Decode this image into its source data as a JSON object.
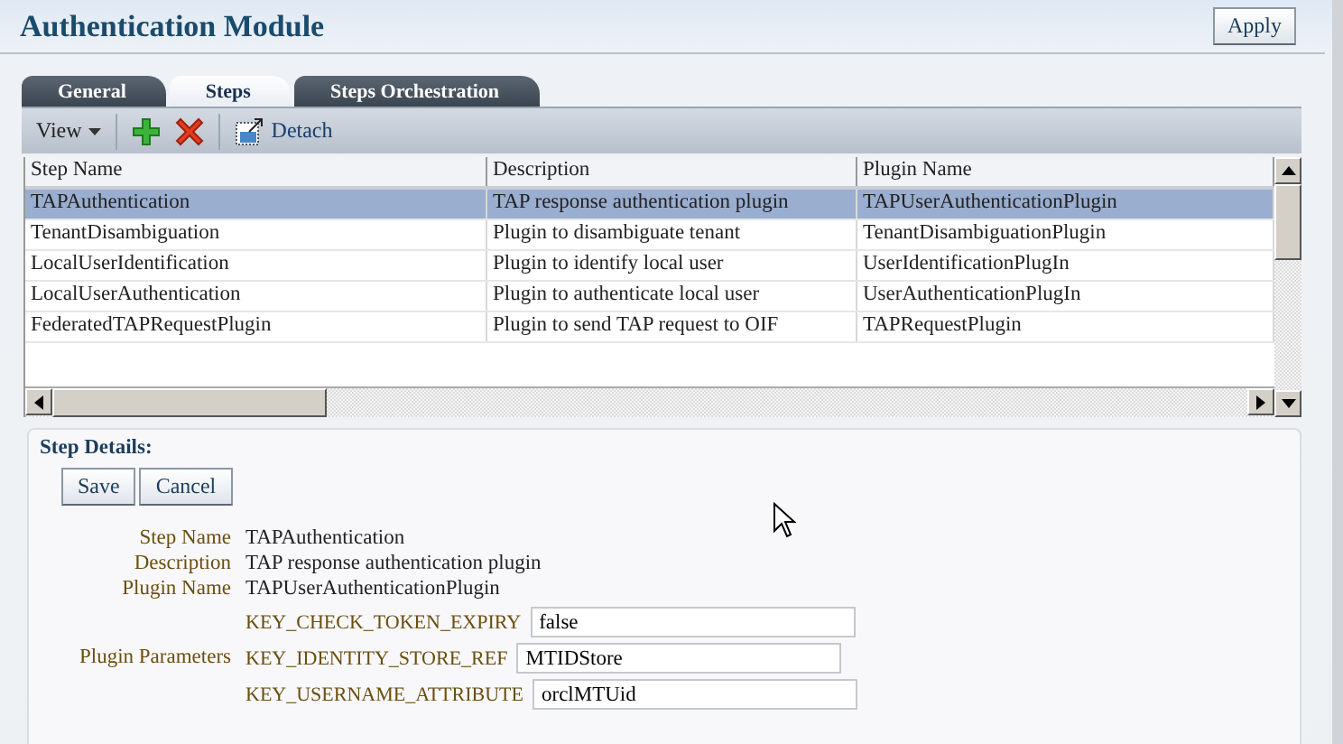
{
  "header": {
    "title": "Authentication Module",
    "apply_button": "Apply"
  },
  "tabs": [
    {
      "label": "General",
      "selected": false
    },
    {
      "label": "Steps",
      "selected": true
    },
    {
      "label": "Steps Orchestration",
      "selected": false
    }
  ],
  "toolbar": {
    "view_menu": "View",
    "detach_button": "Detach"
  },
  "table": {
    "columns": [
      "Step Name",
      "Description",
      "Plugin Name"
    ],
    "rows": [
      {
        "cells": [
          "TAPAuthentication",
          "TAP response authentication plugin",
          "TAPUserAuthenticationPlugin"
        ],
        "selected": true
      },
      {
        "cells": [
          "TenantDisambiguation",
          "Plugin to disambiguate tenant",
          "TenantDisambiguationPlugin"
        ],
        "selected": false
      },
      {
        "cells": [
          "LocalUserIdentification",
          "Plugin to identify local user",
          "UserIdentificationPlugIn"
        ],
        "selected": false
      },
      {
        "cells": [
          "LocalUserAuthentication",
          "Plugin to authenticate local user",
          "UserAuthenticationPlugIn"
        ],
        "selected": false
      },
      {
        "cells": [
          "FederatedTAPRequestPlugin",
          "Plugin to send TAP request to OIF",
          "TAPRequestPlugin"
        ],
        "selected": false
      }
    ]
  },
  "step_details": {
    "title": "Step Details:",
    "buttons": [
      "Save",
      "Cancel"
    ],
    "fields": [
      {
        "label": "Step Name",
        "value": "TAPAuthentication"
      },
      {
        "label": "Description",
        "value": "TAP response authentication plugin"
      },
      {
        "label": "Plugin Name",
        "value": "TAPUserAuthenticationPlugin"
      }
    ],
    "parameters_label": "Plugin Parameters",
    "parameters": [
      {
        "key": "KEY_CHECK_TOKEN_EXPIRY",
        "value": "false"
      },
      {
        "key": "KEY_IDENTITY_STORE_REF",
        "value": "MTIDStore"
      },
      {
        "key": "KEY_USERNAME_ATTRIBUTE",
        "value": "orclMTUid"
      }
    ]
  }
}
